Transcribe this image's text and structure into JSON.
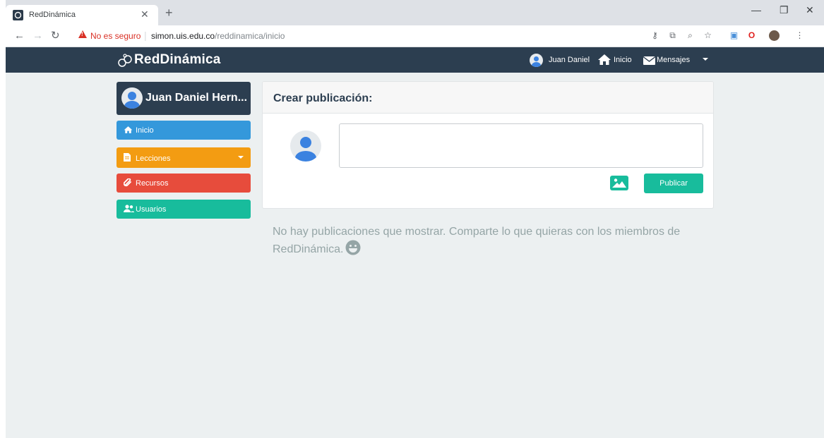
{
  "browser": {
    "tab_title": "RedDinámica",
    "not_secure_label": "No es seguro",
    "url_host": "simon.uis.edu.co",
    "url_path": "/reddinamica/inicio"
  },
  "navbar": {
    "brand": "RedDinámica",
    "user_name": "Juan Daniel",
    "inicio": "Inicio",
    "mensajes": "Mensajes"
  },
  "sidebar": {
    "profile_name": "Juan Daniel Hern...",
    "items": [
      {
        "label": "Inicio",
        "color": "#3498db",
        "icon": "home-icon"
      },
      {
        "label": "Lecciones",
        "color": "#f39c12",
        "icon": "file-icon"
      },
      {
        "label": "Recursos",
        "color": "#e74c3c",
        "icon": "paperclip-icon"
      },
      {
        "label": "Usuarios",
        "color": "#18bc9c",
        "icon": "users-icon"
      }
    ]
  },
  "post": {
    "title": "Crear publicación:",
    "textarea_value": "",
    "publish_label": "Publicar"
  },
  "feed": {
    "empty_message": "No hay publicaciones que mostrar. Comparte lo que quieras con los miembros de RedDinámica."
  },
  "colors": {
    "navbar": "#2c3e50",
    "accent": "#18bc9c",
    "background": "#ecf0f1",
    "muted_text": "#95a5a6"
  }
}
